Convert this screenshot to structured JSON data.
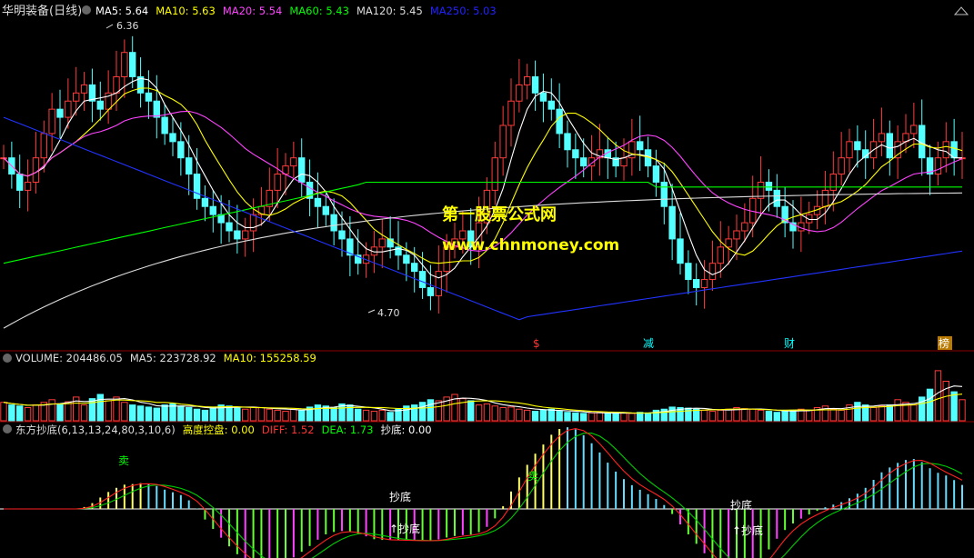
{
  "header": {
    "stock": "华明装备",
    "period": "(日线)",
    "ma_labels": [
      {
        "text": "MA5: 5.64",
        "color": "#ffffff"
      },
      {
        "text": "MA10: 5.63",
        "color": "#ffff00"
      },
      {
        "text": "MA20: 5.54",
        "color": "#ff44ff"
      },
      {
        "text": "MA60: 5.43",
        "color": "#00ff00"
      },
      {
        "text": "MA120: 5.45",
        "color": "#dddddd"
      },
      {
        "text": "MA250: 5.03",
        "color": "#2222ff"
      }
    ],
    "collapse_icon": "triangle-up-icon"
  },
  "watermark": {
    "line1": "第一股票公式网",
    "line2": "www.chnmoney.com"
  },
  "price_annotations": {
    "high": "6.36",
    "low": "4.70"
  },
  "event_markers": [
    {
      "text": "$",
      "color": "#ff3333"
    },
    {
      "text": "减",
      "color": "#00ffff"
    },
    {
      "text": "财",
      "color": "#00ffff"
    },
    {
      "text": "榜",
      "color": "#ffcc00"
    }
  ],
  "volume_header": {
    "items": [
      {
        "text": "VOLUME: 204486.05",
        "color": "#dddddd"
      },
      {
        "text": "MA5: 223728.92",
        "color": "#dddddd"
      },
      {
        "text": "MA10: 155258.59",
        "color": "#ffff00"
      }
    ]
  },
  "indicator_header": {
    "items": [
      {
        "text": "东方抄底(6,13,13,24,80,3,10,6)",
        "color": "#dddddd"
      },
      {
        "text": "高度控盘: 0.00",
        "color": "#ffff00"
      },
      {
        "text": "DIFF: 1.52",
        "color": "#ff3333"
      },
      {
        "text": "DEA: 1.73",
        "color": "#00ff00"
      },
      {
        "text": "抄底: 0.00",
        "color": "#ffffff"
      }
    ]
  },
  "indicator_labels": {
    "buy": "抄底",
    "buy_arrow": "↑抄底",
    "sell": "卖"
  },
  "chart_data": {
    "type": "candlestick",
    "panels": [
      "price",
      "volume",
      "indicator"
    ],
    "price_ylim": [
      4.5,
      6.45
    ],
    "high_mark": 6.36,
    "low_mark": 4.7,
    "ma_last": {
      "MA5": 5.64,
      "MA10": 5.63,
      "MA20": 5.54,
      "MA60": 5.43,
      "MA120": 5.45,
      "MA250": 5.03
    },
    "volume_last": {
      "VOLUME": 204486.05,
      "MA5": 223728.92,
      "MA10": 155258.59
    },
    "indicator_last": {
      "高度控盘": 0.0,
      "DIFF": 1.52,
      "DEA": 1.73,
      "抄底": 0.0
    },
    "close_series": [
      5.6,
      5.5,
      5.4,
      5.45,
      5.6,
      5.75,
      5.9,
      5.85,
      5.95,
      6.0,
      6.05,
      5.95,
      5.9,
      6.0,
      6.1,
      6.25,
      6.1,
      6.0,
      5.95,
      5.85,
      5.75,
      5.7,
      5.6,
      5.5,
      5.35,
      5.3,
      5.25,
      5.2,
      5.15,
      5.1,
      5.15,
      5.25,
      5.3,
      5.4,
      5.5,
      5.55,
      5.6,
      5.45,
      5.35,
      5.3,
      5.25,
      5.15,
      5.1,
      5.0,
      4.95,
      5.0,
      5.05,
      5.1,
      5.05,
      5.0,
      4.95,
      4.9,
      4.8,
      4.75,
      4.9,
      5.05,
      5.1,
      5.15,
      5.05,
      5.2,
      5.4,
      5.6,
      5.8,
      5.95,
      6.05,
      6.1,
      6.0,
      5.95,
      5.9,
      5.75,
      5.65,
      5.6,
      5.55,
      5.6,
      5.65,
      5.6,
      5.55,
      5.6,
      5.7,
      5.65,
      5.55,
      5.45,
      5.3,
      5.1,
      4.95,
      4.85,
      4.8,
      4.85,
      4.95,
      5.05,
      5.1,
      5.15,
      5.2,
      5.35,
      5.45,
      5.4,
      5.3,
      5.2,
      5.15,
      5.2,
      5.25,
      5.3,
      5.4,
      5.5,
      5.6,
      5.7,
      5.65,
      5.6,
      5.7,
      5.75,
      5.6,
      5.7,
      5.75,
      5.8,
      5.6,
      5.5,
      5.6,
      5.7,
      5.6,
      5.6
    ],
    "volume_series": [
      0.35,
      0.3,
      0.28,
      0.25,
      0.3,
      0.35,
      0.4,
      0.32,
      0.36,
      0.45,
      0.3,
      0.42,
      0.5,
      0.38,
      0.45,
      0.35,
      0.3,
      0.28,
      0.26,
      0.24,
      0.3,
      0.32,
      0.28,
      0.25,
      0.22,
      0.2,
      0.26,
      0.3,
      0.28,
      0.24,
      0.22,
      0.26,
      0.25,
      0.22,
      0.2,
      0.18,
      0.22,
      0.2,
      0.26,
      0.3,
      0.28,
      0.25,
      0.32,
      0.3,
      0.22,
      0.2,
      0.18,
      0.2,
      0.16,
      0.22,
      0.28,
      0.3,
      0.35,
      0.4,
      0.38,
      0.45,
      0.5,
      0.42,
      0.38,
      0.3,
      0.32,
      0.28,
      0.25,
      0.26,
      0.22,
      0.2,
      0.18,
      0.2,
      0.22,
      0.18,
      0.16,
      0.15,
      0.14,
      0.15,
      0.16,
      0.14,
      0.13,
      0.15,
      0.14,
      0.16,
      0.15,
      0.2,
      0.22,
      0.26,
      0.25,
      0.24,
      0.22,
      0.2,
      0.18,
      0.2,
      0.22,
      0.25,
      0.23,
      0.22,
      0.2,
      0.18,
      0.16,
      0.18,
      0.2,
      0.22,
      0.2,
      0.25,
      0.28,
      0.22,
      0.2,
      0.3,
      0.35,
      0.3,
      0.25,
      0.28,
      0.3,
      0.4,
      0.35,
      0.3,
      0.45,
      0.6,
      0.95,
      0.75,
      0.55,
      0.4
    ]
  }
}
